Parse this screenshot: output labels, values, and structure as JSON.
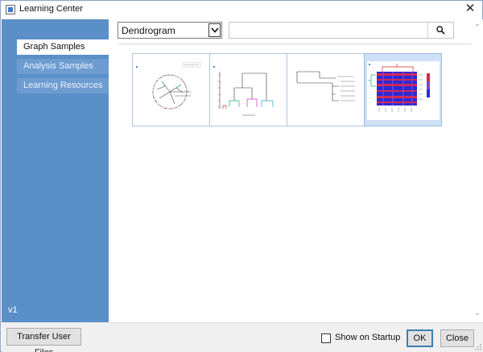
{
  "window": {
    "title": "Learning Center",
    "close_glyph": "✕"
  },
  "sidebar": {
    "items": [
      {
        "label": "Graph Samples",
        "active": true
      },
      {
        "label": "Analysis Samples",
        "active": false
      },
      {
        "label": "Learning Resources",
        "active": false
      }
    ],
    "version": "v1",
    "background": "#5b8fc7"
  },
  "toolbar": {
    "category_value": "Dendrogram",
    "search_value": "",
    "search_icon": "magnifier-icon",
    "dropdown_icon": "chevron-down-icon"
  },
  "thumbnails": [
    {
      "name": "circular-dendrogram",
      "selected": false
    },
    {
      "name": "vertical-dendrogram",
      "selected": false
    },
    {
      "name": "horizontal-dendrogram",
      "selected": false
    },
    {
      "name": "heatmap-dendrogram",
      "selected": true
    }
  ],
  "footer": {
    "transfer_label": "Transfer User Files",
    "startup_label": "Show on Startup",
    "startup_checked": false,
    "ok_label": "OK",
    "close_label": "Close"
  },
  "colors": {
    "selection": "#cfe1f7",
    "accent": "#3c7fb1"
  }
}
